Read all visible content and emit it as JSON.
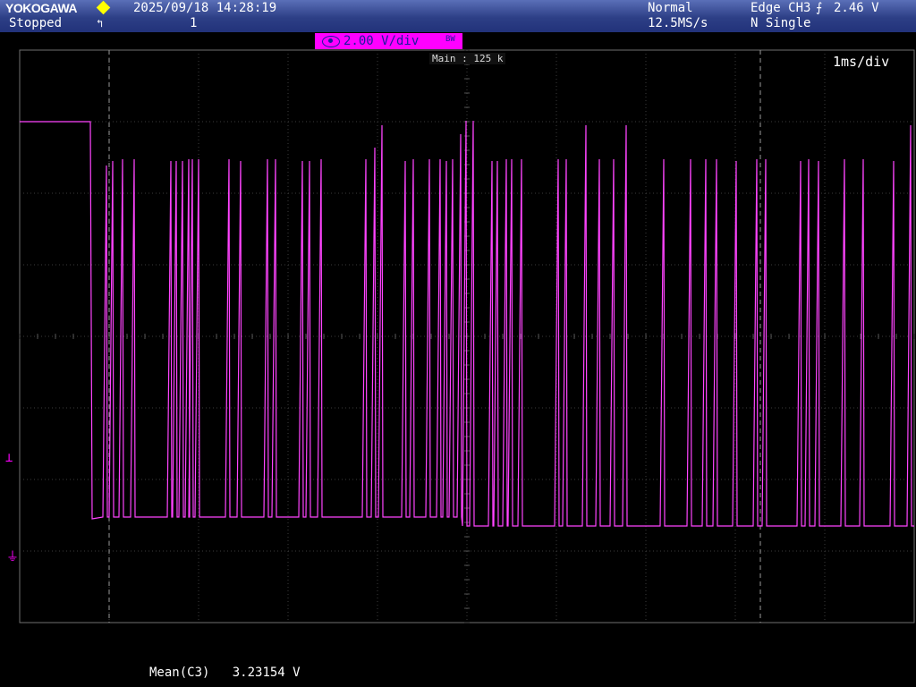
{
  "header": {
    "brand": "YOKOGAWA",
    "status": "Stopped",
    "datetime": "2025/09/18 14:28:19",
    "acq_count": "1",
    "acq_mode": "Normal",
    "sample_rate": "12.5MS/s",
    "trigger_info": "Edge CH3",
    "trigger_level": "2.46 V",
    "trigger_mode": "N Single"
  },
  "channel": {
    "scale": "2.00 V/div",
    "bw_label": "BW",
    "color": "#ff44ff"
  },
  "display": {
    "main_label": "Main : 125 k",
    "time_div": "1ms/div",
    "grid_color": "#3c3c3c"
  },
  "measurement": {
    "label": "Mean(C3)",
    "value": "3.23154 V"
  },
  "icons": {
    "trigger_status": "trigger-flag-icon",
    "edge": "rising-edge-icon",
    "trigger_marker": "trigger-level-marker-icon",
    "ground_marker": "ground-marker-icon"
  }
}
